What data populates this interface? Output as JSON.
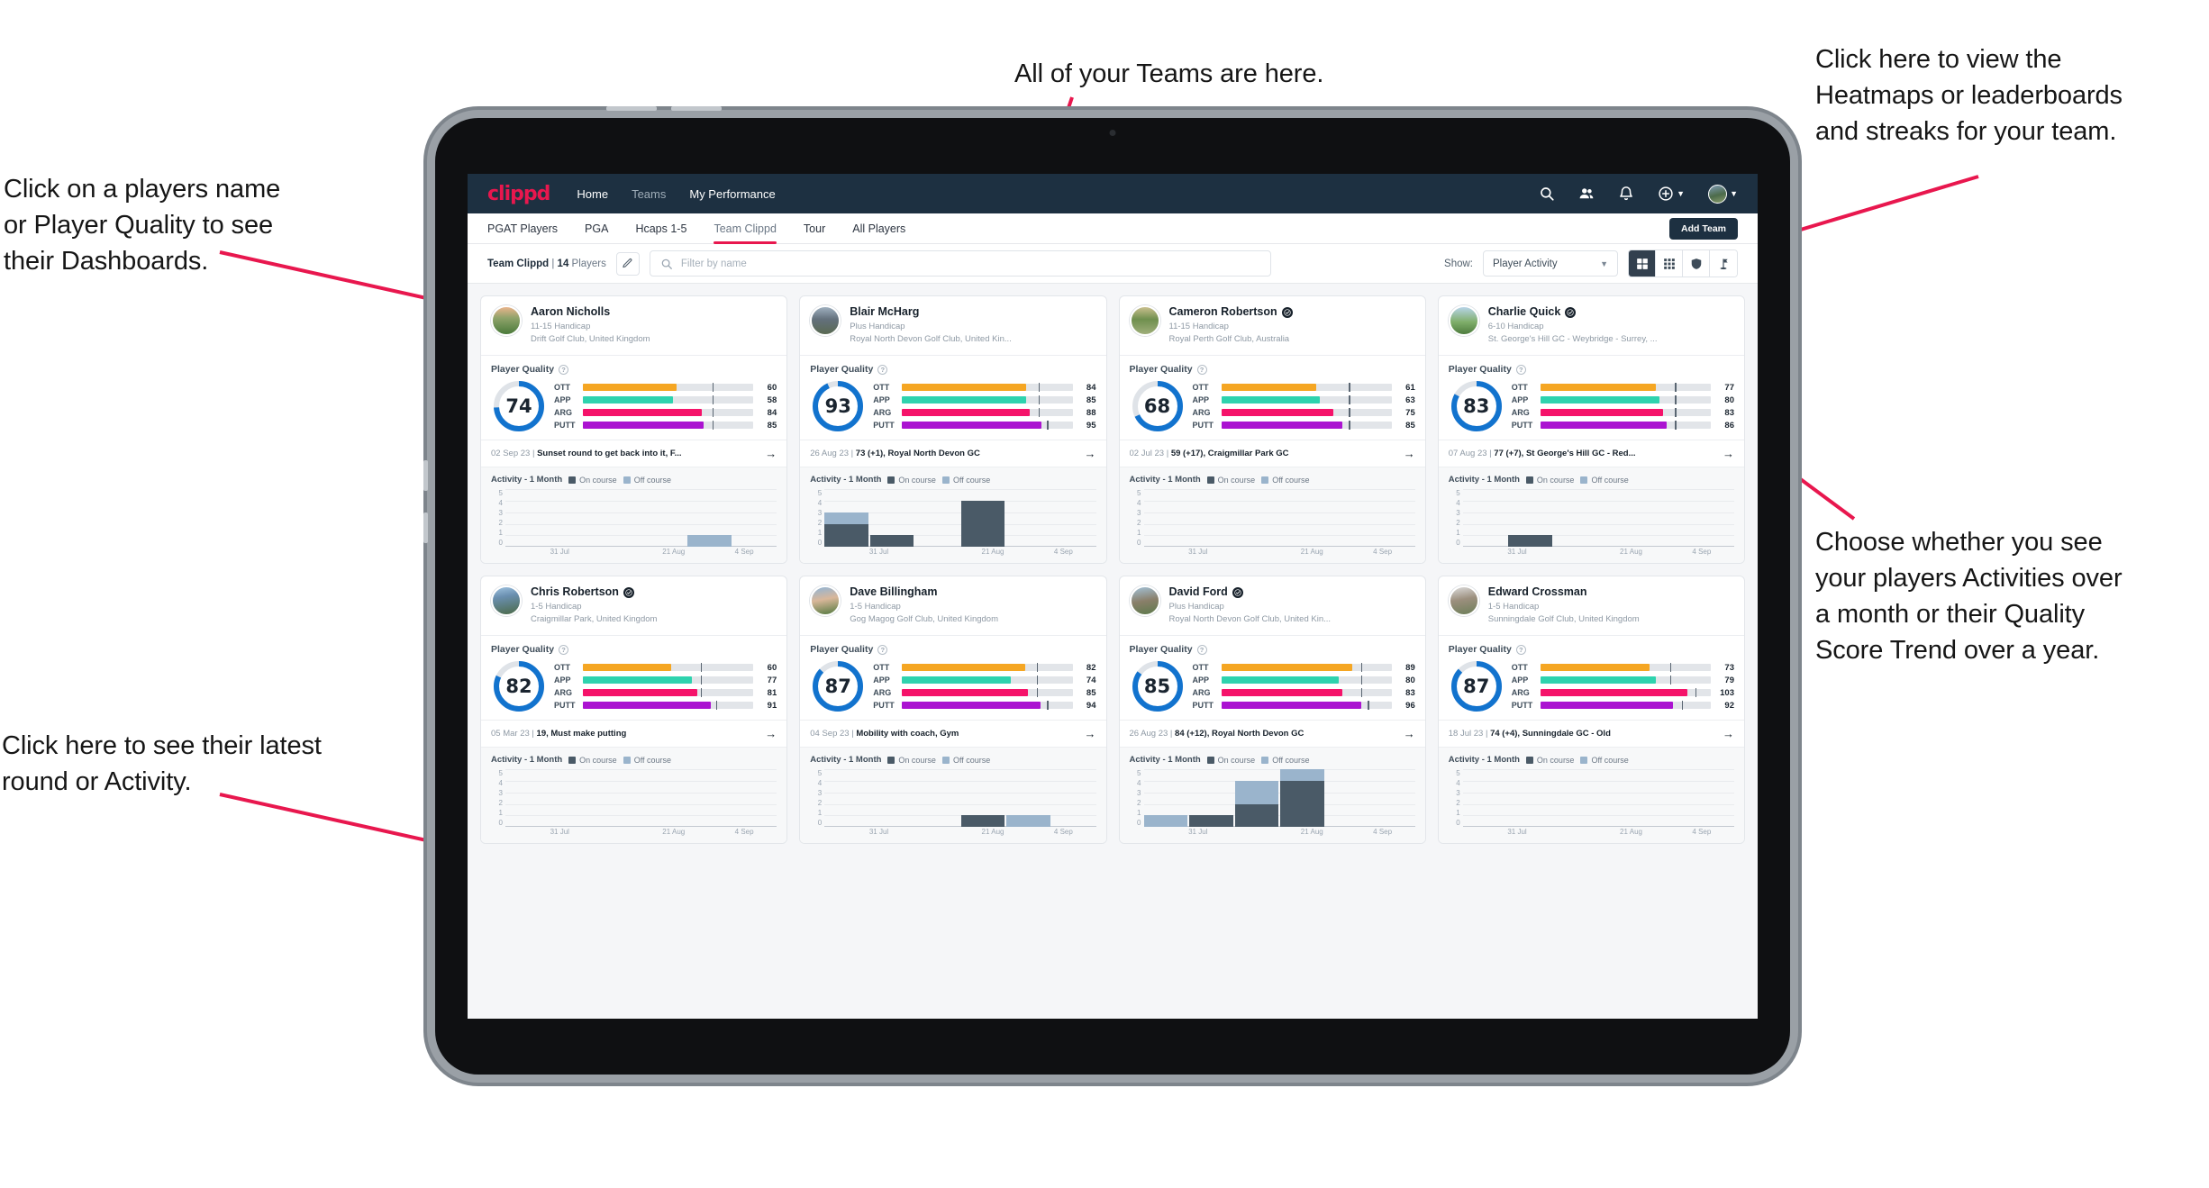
{
  "annotations": [
    {
      "id": "teams",
      "text": "All of your Teams are here."
    },
    {
      "id": "heatmaps",
      "text": "Click here to view the\nHeatmaps or leaderboards\nand streaks for your team."
    },
    {
      "id": "players-name",
      "text": "Click on a players name\nor Player Quality to see\ntheir Dashboards."
    },
    {
      "id": "choose-view",
      "text": "Choose whether you see\nyour players Activities over\na month or their Quality\nScore Trend over a year."
    },
    {
      "id": "latest-round",
      "text": "Click here to see their latest\nround or Activity."
    }
  ],
  "topnav": {
    "brand": "clippd",
    "links": [
      {
        "label": "Home",
        "active": true
      },
      {
        "label": "Teams",
        "active": false
      },
      {
        "label": "My Performance",
        "active": true
      }
    ],
    "icons": [
      "search-icon",
      "people-icon",
      "bell-icon",
      "plus-circle-icon",
      "avatar"
    ]
  },
  "tabs": [
    {
      "label": "PGAT Players",
      "active": false
    },
    {
      "label": "PGA",
      "active": false
    },
    {
      "label": "Hcaps 1-5",
      "active": false
    },
    {
      "label": "Team Clippd",
      "active": true
    },
    {
      "label": "Tour",
      "active": false
    },
    {
      "label": "All Players",
      "active": false
    }
  ],
  "add_team_label": "Add Team",
  "filterbar": {
    "team_name": "Team Clippd",
    "separator": " | ",
    "player_count": "14",
    "players_word": " Players",
    "search_placeholder": "Filter by name",
    "search_value": "",
    "show_label": "Show:",
    "show_value": "Player Activity",
    "view_modes": [
      "grid-large-icon",
      "grid-small-icon",
      "shield-icon",
      "flag-icon"
    ],
    "active_view": 0
  },
  "card_labels": {
    "player_quality": "Player Quality",
    "activity_title": "Activity - 1 Month",
    "legend_on": "On course",
    "legend_off": "Off course",
    "metrics": [
      "OTT",
      "APP",
      "ARG",
      "PUTT"
    ],
    "y_ticks": [
      "5",
      "4",
      "3",
      "2",
      "1",
      "0"
    ],
    "x_ticks": [
      "31 Jul",
      "21 Aug",
      "4 Sep"
    ]
  },
  "colors": {
    "brand": "#e8174e",
    "navy": "#1d3041",
    "ring": "#1273ce",
    "ott": "#f5a623",
    "app": "#2ed3ae",
    "arg": "#f5136a",
    "putt": "#ab13d1",
    "on_course": "#4a5a67",
    "off_course": "#9ab4cc"
  },
  "players": [
    {
      "name": "Aaron Nicholls",
      "verified": false,
      "avatar": "av1",
      "handicap": "11-15 Handicap",
      "club": "Drift Golf Club, United Kingdom",
      "quality": 74,
      "metrics": [
        {
          "label": "OTT",
          "value": 60,
          "fill": 55,
          "tick": 76
        },
        {
          "label": "APP",
          "value": 58,
          "fill": 53,
          "tick": 76
        },
        {
          "label": "ARG",
          "value": 84,
          "fill": 70,
          "tick": 76
        },
        {
          "label": "PUTT",
          "value": 85,
          "fill": 71,
          "tick": 76
        }
      ],
      "round_date": "02 Sep 23",
      "round_text": "Sunset round to get back into it, F...",
      "activity": [
        {
          "on": 0,
          "off": 0
        },
        {
          "on": 0,
          "off": 0
        },
        {
          "on": 0,
          "off": 0
        },
        {
          "on": 0,
          "off": 0
        },
        {
          "on": 0,
          "off": 1
        },
        {
          "on": 0,
          "off": 0
        }
      ]
    },
    {
      "name": "Blair McHarg",
      "verified": false,
      "avatar": "av2",
      "handicap": "Plus Handicap",
      "club": "Royal North Devon Golf Club, United Kin...",
      "quality": 93,
      "metrics": [
        {
          "label": "OTT",
          "value": 84,
          "fill": 73,
          "tick": 80
        },
        {
          "label": "APP",
          "value": 85,
          "fill": 73,
          "tick": 80
        },
        {
          "label": "ARG",
          "value": 88,
          "fill": 75,
          "tick": 80
        },
        {
          "label": "PUTT",
          "value": 95,
          "fill": 82,
          "tick": 85
        }
      ],
      "round_date": "26 Aug 23",
      "round_text": "73 (+1), Royal North Devon GC",
      "activity": [
        {
          "on": 2,
          "off": 1
        },
        {
          "on": 1,
          "off": 0
        },
        {
          "on": 0,
          "off": 0
        },
        {
          "on": 4,
          "off": 0
        },
        {
          "on": 0,
          "off": 0
        },
        {
          "on": 0,
          "off": 0
        }
      ]
    },
    {
      "name": "Cameron Robertson",
      "verified": true,
      "avatar": "av3",
      "handicap": "11-15 Handicap",
      "club": "Royal Perth Golf Club, Australia",
      "quality": 68,
      "metrics": [
        {
          "label": "OTT",
          "value": 61,
          "fill": 56,
          "tick": 75
        },
        {
          "label": "APP",
          "value": 63,
          "fill": 58,
          "tick": 75
        },
        {
          "label": "ARG",
          "value": 75,
          "fill": 66,
          "tick": 75
        },
        {
          "label": "PUTT",
          "value": 85,
          "fill": 71,
          "tick": 75
        }
      ],
      "round_date": "02 Jul 23",
      "round_text": "59 (+17), Craigmillar Park GC",
      "activity": [
        {
          "on": 0,
          "off": 0
        },
        {
          "on": 0,
          "off": 0
        },
        {
          "on": 0,
          "off": 0
        },
        {
          "on": 0,
          "off": 0
        },
        {
          "on": 0,
          "off": 0
        },
        {
          "on": 0,
          "off": 0
        }
      ]
    },
    {
      "name": "Charlie Quick",
      "verified": true,
      "avatar": "av4",
      "handicap": "6-10 Handicap",
      "club": "St. George's Hill GC - Weybridge - Surrey, ...",
      "quality": 83,
      "metrics": [
        {
          "label": "OTT",
          "value": 77,
          "fill": 68,
          "tick": 79
        },
        {
          "label": "APP",
          "value": 80,
          "fill": 70,
          "tick": 79
        },
        {
          "label": "ARG",
          "value": 83,
          "fill": 72,
          "tick": 79
        },
        {
          "label": "PUTT",
          "value": 86,
          "fill": 74,
          "tick": 79
        }
      ],
      "round_date": "07 Aug 23",
      "round_text": "77 (+7), St George's Hill GC - Red...",
      "activity": [
        {
          "on": 0,
          "off": 0
        },
        {
          "on": 1,
          "off": 0
        },
        {
          "on": 0,
          "off": 0
        },
        {
          "on": 0,
          "off": 0
        },
        {
          "on": 0,
          "off": 0
        },
        {
          "on": 0,
          "off": 0
        }
      ]
    },
    {
      "name": "Chris Robertson",
      "verified": true,
      "avatar": "av5",
      "handicap": "1-5 Handicap",
      "club": "Craigmillar Park, United Kingdom",
      "quality": 82,
      "metrics": [
        {
          "label": "OTT",
          "value": 60,
          "fill": 52,
          "tick": 69
        },
        {
          "label": "APP",
          "value": 77,
          "fill": 64,
          "tick": 69
        },
        {
          "label": "ARG",
          "value": 81,
          "fill": 67,
          "tick": 69
        },
        {
          "label": "PUTT",
          "value": 91,
          "fill": 75,
          "tick": 78
        }
      ],
      "round_date": "05 Mar 23",
      "round_text": "19, Must make putting",
      "activity": [
        {
          "on": 0,
          "off": 0
        },
        {
          "on": 0,
          "off": 0
        },
        {
          "on": 0,
          "off": 0
        },
        {
          "on": 0,
          "off": 0
        },
        {
          "on": 0,
          "off": 0
        },
        {
          "on": 0,
          "off": 0
        }
      ]
    },
    {
      "name": "Dave Billingham",
      "verified": false,
      "avatar": "av6",
      "handicap": "1-5 Handicap",
      "club": "Gog Magog Golf Club, United Kingdom",
      "quality": 87,
      "metrics": [
        {
          "label": "OTT",
          "value": 82,
          "fill": 72,
          "tick": 79
        },
        {
          "label": "APP",
          "value": 74,
          "fill": 64,
          "tick": 79
        },
        {
          "label": "ARG",
          "value": 85,
          "fill": 74,
          "tick": 79
        },
        {
          "label": "PUTT",
          "value": 94,
          "fill": 81,
          "tick": 85
        }
      ],
      "round_date": "04 Sep 23",
      "round_text": "Mobility with coach, Gym",
      "activity": [
        {
          "on": 0,
          "off": 0
        },
        {
          "on": 0,
          "off": 0
        },
        {
          "on": 0,
          "off": 0
        },
        {
          "on": 1,
          "off": 0
        },
        {
          "on": 0,
          "off": 1
        },
        {
          "on": 0,
          "off": 0
        }
      ]
    },
    {
      "name": "David Ford",
      "verified": true,
      "avatar": "av7",
      "handicap": "Plus Handicap",
      "club": "Royal North Devon Golf Club, United Kin...",
      "quality": 85,
      "metrics": [
        {
          "label": "OTT",
          "value": 89,
          "fill": 77,
          "tick": 82
        },
        {
          "label": "APP",
          "value": 80,
          "fill": 69,
          "tick": 82
        },
        {
          "label": "ARG",
          "value": 83,
          "fill": 71,
          "tick": 82
        },
        {
          "label": "PUTT",
          "value": 96,
          "fill": 82,
          "tick": 86
        }
      ],
      "round_date": "26 Aug 23",
      "round_text": "84 (+12), Royal North Devon GC",
      "activity": [
        {
          "on": 0,
          "off": 1
        },
        {
          "on": 1,
          "off": 0
        },
        {
          "on": 2,
          "off": 2
        },
        {
          "on": 4,
          "off": 1
        },
        {
          "on": 0,
          "off": 0
        },
        {
          "on": 0,
          "off": 0
        }
      ]
    },
    {
      "name": "Edward Crossman",
      "verified": false,
      "avatar": "av8",
      "handicap": "1-5 Handicap",
      "club": "Sunningdale Golf Club, United Kingdom",
      "quality": 87,
      "metrics": [
        {
          "label": "OTT",
          "value": 73,
          "fill": 64,
          "tick": 76
        },
        {
          "label": "APP",
          "value": 79,
          "fill": 68,
          "tick": 76
        },
        {
          "label": "ARG",
          "value": 103,
          "fill": 86,
          "tick": 91
        },
        {
          "label": "PUTT",
          "value": 92,
          "fill": 78,
          "tick": 83
        }
      ],
      "round_date": "18 Jul 23",
      "round_text": "74 (+4), Sunningdale GC - Old",
      "activity": [
        {
          "on": 0,
          "off": 0
        },
        {
          "on": 0,
          "off": 0
        },
        {
          "on": 0,
          "off": 0
        },
        {
          "on": 0,
          "off": 0
        },
        {
          "on": 0,
          "off": 0
        },
        {
          "on": 0,
          "off": 0
        }
      ]
    }
  ]
}
